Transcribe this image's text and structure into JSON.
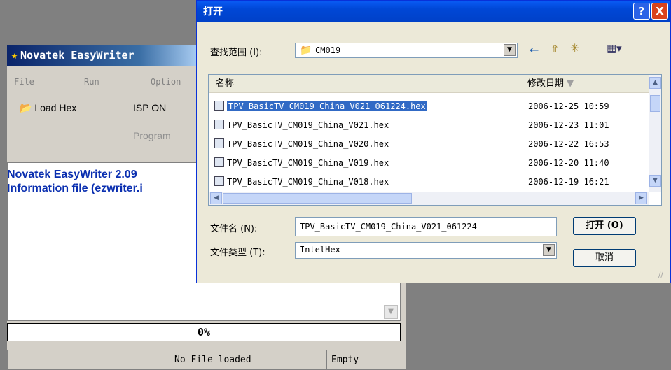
{
  "app": {
    "title": "Novatek EasyWriter",
    "menu": [
      "File",
      "Run",
      "Option"
    ],
    "toolbar": {
      "load_hex": "Load Hex",
      "isp_on": "ISP ON",
      "program": "Program"
    },
    "log_lines": [
      "Novatek EasyWriter  2.09",
      "Information file (ezwriter.i"
    ],
    "progress": "0%",
    "progress_value": 0,
    "status": {
      "file": "No File loaded",
      "state": "Empty"
    }
  },
  "dialog": {
    "title": "打开",
    "look_in_label": "查找范围 (I):",
    "look_in_value": "CM019",
    "columns": {
      "name": "名称",
      "date": "修改日期"
    },
    "files": [
      {
        "name": "TPV_BasicTV_CM019_China_V021_061224.hex",
        "date": "2006-12-25 10:59",
        "selected": true
      },
      {
        "name": "TPV_BasicTV_CM019_China_V021.hex",
        "date": "2006-12-23 11:01",
        "selected": false
      },
      {
        "name": "TPV_BasicTV_CM019_China_V020.hex",
        "date": "2006-12-22 16:53",
        "selected": false
      },
      {
        "name": "TPV_BasicTV_CM019_China_V019.hex",
        "date": "2006-12-20 11:40",
        "selected": false
      },
      {
        "name": "TPV_BasicTV_CM019_China_V018.hex",
        "date": "2006-12-19 16:21",
        "selected": false
      }
    ],
    "filename_label": "文件名 (N):",
    "filename_value": "TPV_BasicTV_CM019_China_V021_061224",
    "filetype_label": "文件类型 (T):",
    "filetype_value": "IntelHex",
    "open_button": "打开 (O)",
    "cancel_button": "取消",
    "help_button": "?",
    "close_button": "X",
    "icons": [
      "help-icon",
      "close-icon",
      "folder-icon",
      "back-arrow-icon",
      "up-folder-icon",
      "new-folder-icon",
      "view-menu-icon",
      "chevron-down-icon",
      "file-icon"
    ]
  }
}
